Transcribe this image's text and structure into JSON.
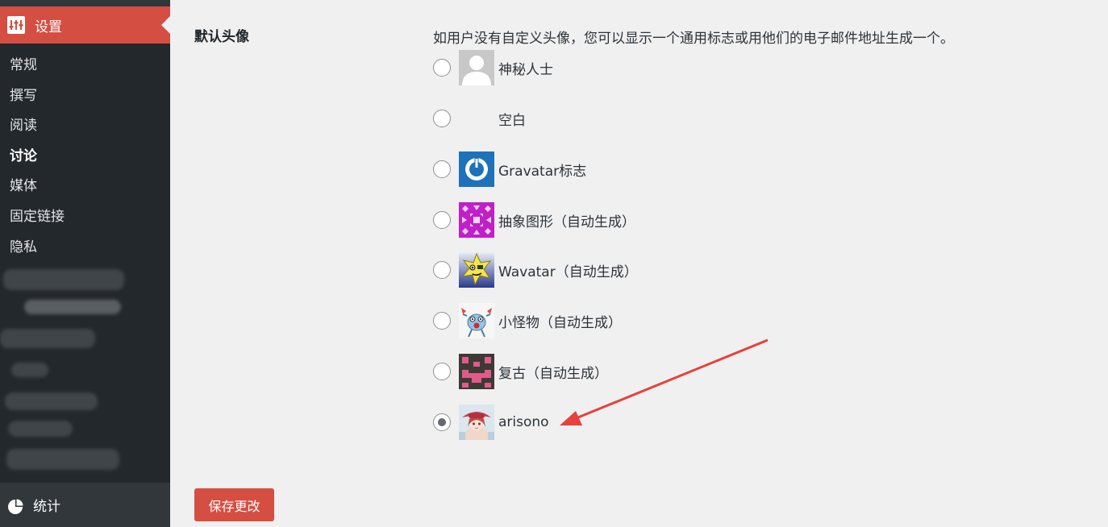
{
  "sidebar": {
    "active_menu": "设置",
    "submenu": [
      {
        "label": "常规",
        "current": false
      },
      {
        "label": "撰写",
        "current": false
      },
      {
        "label": "阅读",
        "current": false
      },
      {
        "label": "讨论",
        "current": true
      },
      {
        "label": "媒体",
        "current": false
      },
      {
        "label": "固定链接",
        "current": false
      },
      {
        "label": "隐私",
        "current": false
      }
    ],
    "stats_label": "统计"
  },
  "main": {
    "field_label": "默认头像",
    "description": "如用户没有自定义头像，您可以显示一个通用标志或用他们的电子邮件地址生成一个。",
    "options": [
      {
        "label": "神秘人士",
        "icon": "mystery-person-avatar",
        "checked": false
      },
      {
        "label": "空白",
        "icon": "blank-avatar",
        "checked": false
      },
      {
        "label": "Gravatar标志",
        "icon": "gravatar-logo-avatar",
        "checked": false
      },
      {
        "label": "抽象图形（自动生成）",
        "icon": "identicon-avatar",
        "checked": false
      },
      {
        "label": "Wavatar（自动生成）",
        "icon": "wavatar-avatar",
        "checked": false
      },
      {
        "label": "小怪物（自动生成）",
        "icon": "monsterid-avatar",
        "checked": false
      },
      {
        "label": "复古（自动生成）",
        "icon": "retro-avatar",
        "checked": false
      },
      {
        "label": "arisono",
        "icon": "custom-anime-avatar",
        "checked": true
      }
    ],
    "save_label": "保存更改"
  },
  "colors": {
    "accent": "#d54e42",
    "sidebar_bg": "#23282d",
    "page_bg": "#f0f0f1",
    "annotation_arrow": "#e8403a"
  }
}
